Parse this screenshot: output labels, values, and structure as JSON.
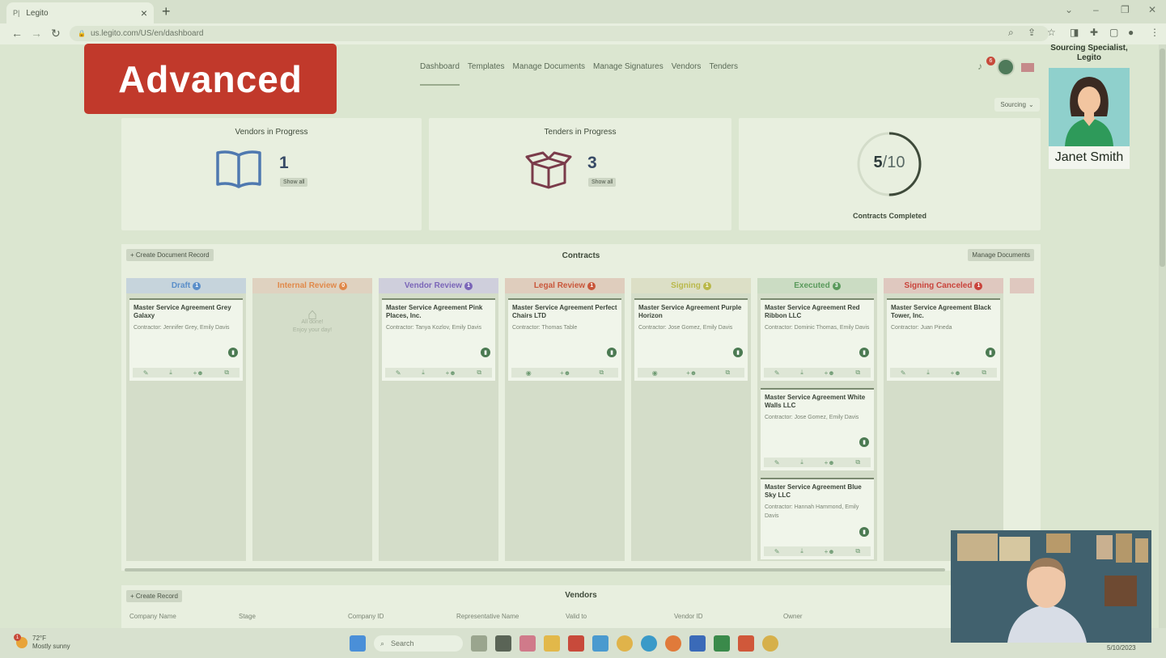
{
  "browser": {
    "tab_title": "Legito",
    "tab_favicon": "P|",
    "url": "us.legito.com/US/en/dashboard"
  },
  "overlay_label": "Advanced",
  "nav": {
    "items": [
      "Dashboard",
      "Templates",
      "Manage Documents",
      "Manage Signatures",
      "Vendors",
      "Tenders"
    ],
    "active": "Dashboard"
  },
  "header": {
    "notification_count": "6",
    "sourcing_label": "Sourcing"
  },
  "persona": {
    "role": "Sourcing Specialist, Legito",
    "name": "Janet Smith"
  },
  "stats": {
    "vendors": {
      "title": "Vendors in Progress",
      "count": "1",
      "show_all": "Show all"
    },
    "tenders": {
      "title": "Tenders in Progress",
      "count": "3",
      "show_all": "Show all"
    },
    "contracts": {
      "done": "5",
      "total": "/10",
      "progress": 0.5,
      "label": "Contracts Completed"
    }
  },
  "contracts": {
    "title": "Contracts",
    "create_label": "+ Create Document Record",
    "manage_label": "Manage Documents",
    "columns": [
      {
        "name": "Draft",
        "count": "1",
        "color": "#5b8fc9"
      },
      {
        "name": "Internal Review",
        "count": "0",
        "color": "#e0894a"
      },
      {
        "name": "Vendor Review",
        "count": "1",
        "color": "#7b66b8"
      },
      {
        "name": "Legal Review",
        "count": "1",
        "color": "#c9573b"
      },
      {
        "name": "Signing",
        "count": "1",
        "color": "#b9b84a"
      },
      {
        "name": "Executed",
        "count": "3",
        "color": "#5a9a5c"
      },
      {
        "name": "Signing Canceled",
        "count": "1",
        "color": "#c9433b"
      }
    ],
    "empty": {
      "line1": "All done!",
      "line2": "Enjoy your day!"
    },
    "cards": [
      {
        "title": "Master Service Agreement Grey Galaxy",
        "contractor": "Contractor: Jennifer Grey, Emily Davis"
      },
      {
        "title": "Master Service Agreement Pink Places, Inc.",
        "contractor": "Contractor: Tanya Kozlov, Emily Davis"
      },
      {
        "title": "Master Service Agreement Perfect Chairs LTD",
        "contractor": "Contractor: Thomas Table"
      },
      {
        "title": "Master Service Agreement Purple Horizon",
        "contractor": "Contractor: Jose Gomez, Emily Davis"
      },
      {
        "title": "Master Service Agreement Red Ribbon LLC",
        "contractor": "Contractor: Dominic Thomas, Emily Davis"
      },
      {
        "title": "Master Service Agreement White Walls LLC",
        "contractor": "Contractor: Jose Gomez, Emily Davis"
      },
      {
        "title": "Master Service Agreement Blue Sky LLC",
        "contractor": "Contractor: Hannah Hammond, Emily Davis"
      },
      {
        "title": "Master Service Agreement Black Tower, Inc.",
        "contractor": "Contractor: Juan Pineda"
      }
    ]
  },
  "vendors": {
    "title": "Vendors",
    "create_label": "+ Create Record",
    "columns": [
      "Company Name",
      "Stage",
      "Company ID",
      "Representative Name",
      "Valid to",
      "Vendor ID",
      "Owner"
    ]
  },
  "taskbar": {
    "temp": "72°F",
    "condition": "Mostly sunny",
    "weather_badge": "1",
    "search": "Search",
    "date": "5/10/2023"
  }
}
